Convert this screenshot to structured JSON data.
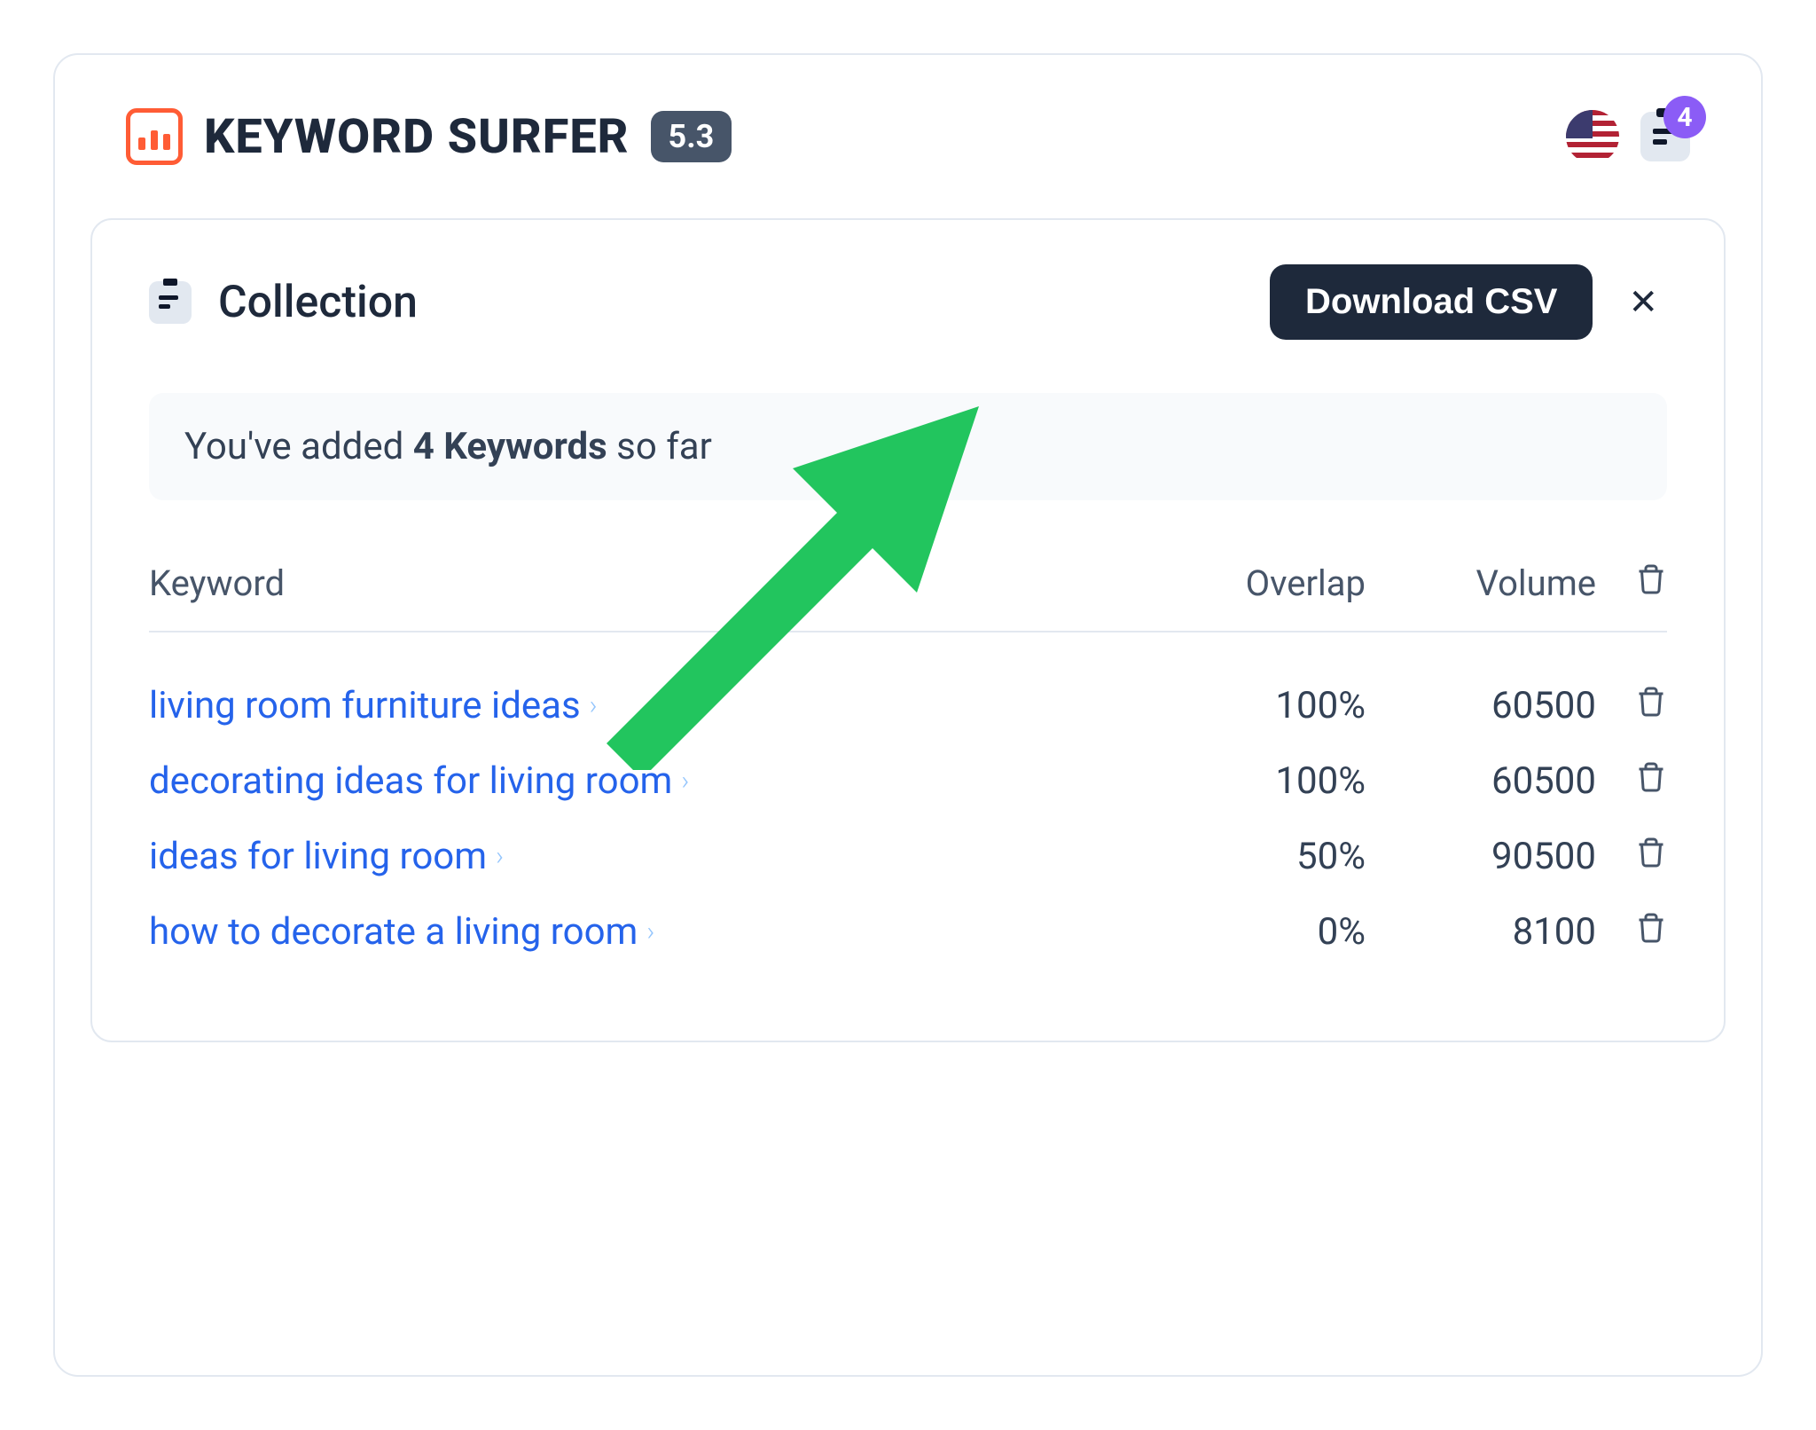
{
  "header": {
    "title": "KEYWORD SURFER",
    "version": "5.3",
    "clipboard_count": "4"
  },
  "collection": {
    "title": "Collection",
    "download_label": "Download CSV",
    "banner_prefix": "You've added ",
    "banner_strong": "4 Keywords",
    "banner_suffix": " so far"
  },
  "columns": {
    "keyword": "Keyword",
    "overlap": "Overlap",
    "volume": "Volume"
  },
  "rows": [
    {
      "keyword": "living room furniture ideas",
      "overlap": "100%",
      "volume": "60500"
    },
    {
      "keyword": "decorating ideas for living room",
      "overlap": "100%",
      "volume": "60500"
    },
    {
      "keyword": "ideas for living room",
      "overlap": "50%",
      "volume": "90500"
    },
    {
      "keyword": "how to decorate a living room",
      "overlap": "0%",
      "volume": "8100"
    }
  ],
  "annotation": {
    "arrow_color": "#22c55e"
  }
}
